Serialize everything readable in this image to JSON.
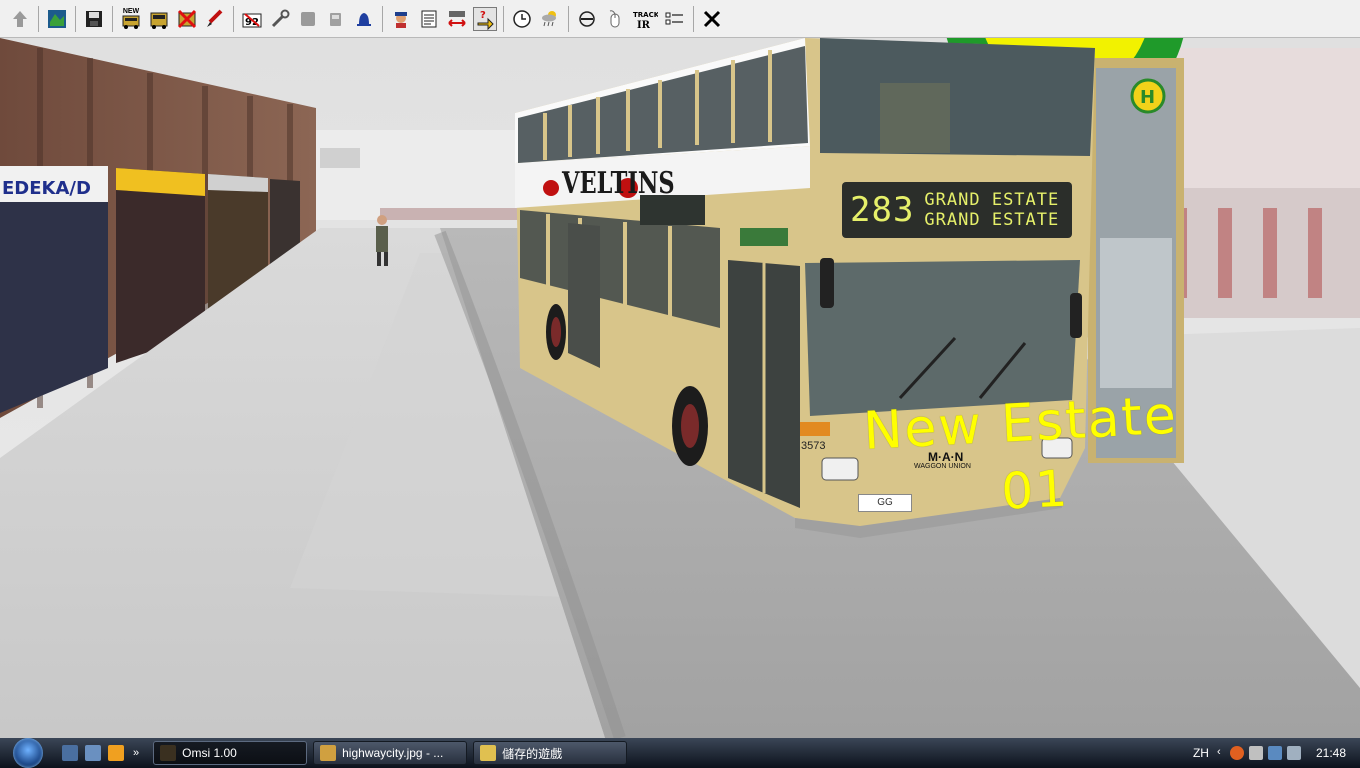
{
  "toolbar": {
    "buttons": [
      {
        "name": "up-arrow-icon"
      },
      {
        "name": "map-icon"
      },
      {
        "name": "save-icon"
      },
      {
        "name": "new-bus-icon",
        "label": "NEW"
      },
      {
        "name": "bus-icon"
      },
      {
        "name": "delete-bus-icon"
      },
      {
        "name": "pencil-icon"
      },
      {
        "name": "ignition-icon"
      },
      {
        "name": "wrench-icon"
      },
      {
        "name": "grey-block-icon"
      },
      {
        "name": "fuel-icon"
      },
      {
        "name": "bell-icon"
      },
      {
        "name": "driver-icon"
      },
      {
        "name": "timetable-icon"
      },
      {
        "name": "swap-arrows-icon"
      },
      {
        "name": "help-arrow-icon"
      },
      {
        "name": "clock-icon"
      },
      {
        "name": "weather-icon"
      },
      {
        "name": "compass-icon"
      },
      {
        "name": "mouse-icon"
      },
      {
        "name": "trackir-icon",
        "label": "TRACK IR"
      },
      {
        "name": "options-icon"
      },
      {
        "name": "close-icon"
      }
    ]
  },
  "scene": {
    "overlay_line1": "New Estate",
    "overlay_line2": "01",
    "destination": {
      "route": "283",
      "line1": "GRAND ESTATE",
      "line2": "GRAND ESTATE"
    },
    "ad_text": "VELTINS",
    "fleet_number": "3573",
    "plate": "GG",
    "manufacturer": "M·A·N",
    "manufacturer_sub": "WAGGON UNION"
  },
  "taskbar": {
    "tasks": [
      {
        "label": "Omsi 1.00"
      },
      {
        "label": "highwaycity.jpg - ..."
      },
      {
        "label": "儲存的遊戲"
      }
    ],
    "ql_more": "»",
    "language": "ZH",
    "clock": "21:48"
  },
  "colors": {
    "overlay_text": "#ffff00",
    "toolbar_bg": "#f0f0f0",
    "bus_body": "#d8c58a"
  }
}
